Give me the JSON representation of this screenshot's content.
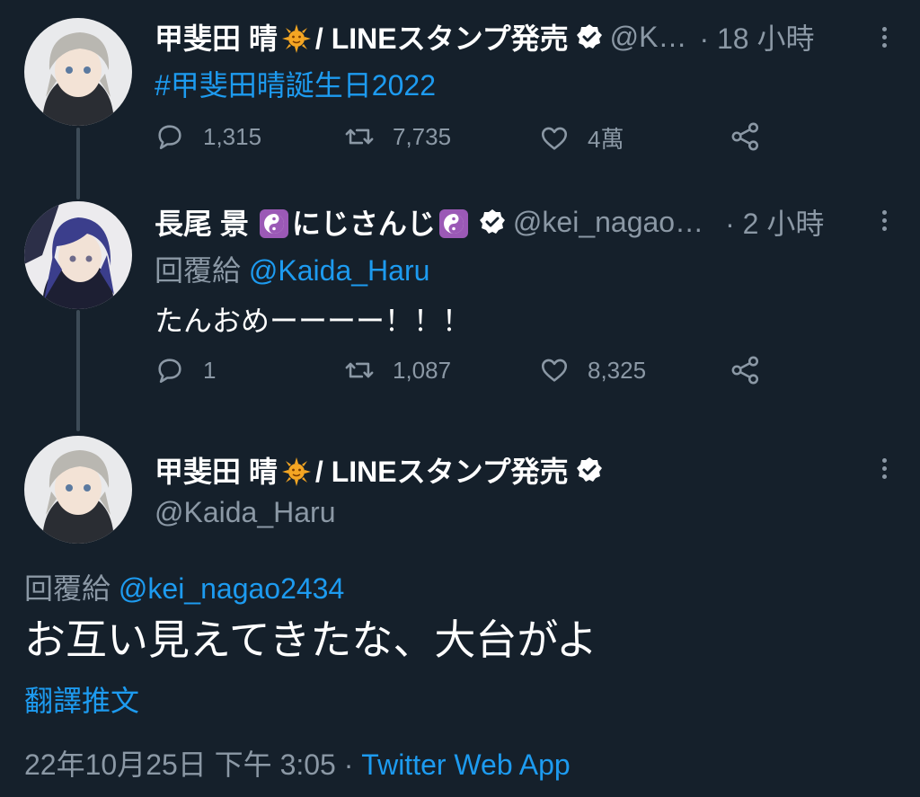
{
  "tweet1": {
    "name": "甲斐田 晴",
    "suffix": " / LINEスタンプ発売",
    "handle": "@K…",
    "time": "· 18 小時",
    "hashtag": "#甲斐田晴誕生日2022",
    "reply_count": "1,315",
    "retweet_count": "7,735",
    "like_count": "4萬"
  },
  "tweet2": {
    "name": "長尾 景",
    "middle": "にじさんじ",
    "handle": "@kei_nagao…",
    "time": "· 2 小時",
    "reply_prefix": "回覆給",
    "reply_to": "@Kaida_Haru",
    "body": "たんおめーーーー！！！",
    "reply_count": "1",
    "retweet_count": "1,087",
    "like_count": "8,325"
  },
  "main_tweet": {
    "name": "甲斐田 晴",
    "suffix": " / LINEスタンプ発売",
    "handle": "@Kaida_Haru",
    "reply_prefix": "回覆給",
    "reply_to": "@kei_nagao2434",
    "body": "お互い見えてきたな、大台がよ",
    "translate": "翻譯推文",
    "timestamp": "22年10月25日 下午 3:05 · ",
    "source": "Twitter Web App"
  },
  "colors": {
    "background": "#15202b",
    "text": "#ffffff",
    "muted": "#8b98a5",
    "link": "#1d9bf0"
  }
}
